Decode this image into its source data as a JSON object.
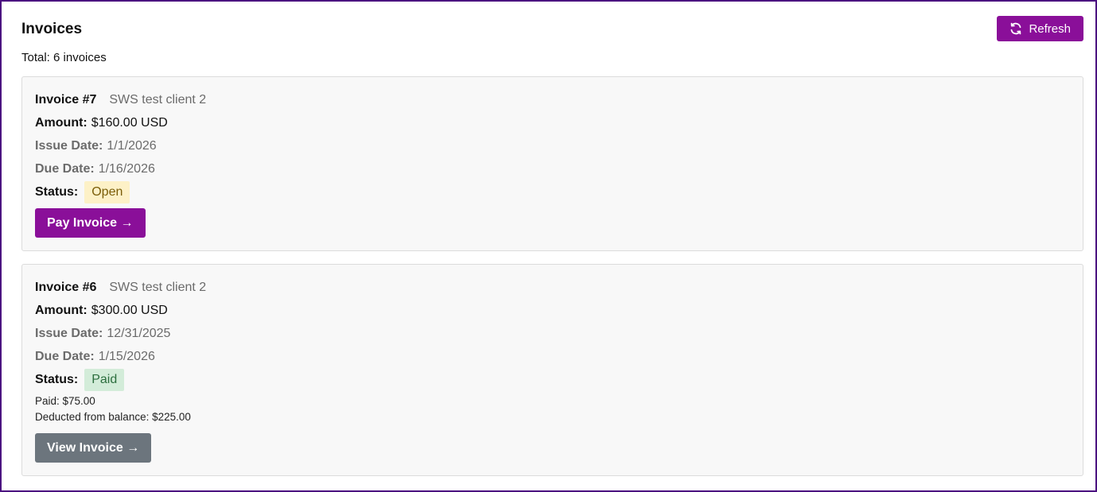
{
  "page": {
    "title": "Invoices",
    "refresh_label": "Refresh",
    "total_text": "Total: 6 invoices"
  },
  "colors": {
    "accent": "#8a0f99",
    "secondary_button": "#6c757d",
    "open_badge_bg": "#fdf1c7",
    "paid_badge_bg": "#d3ecd9",
    "frame_border": "#4b0f80"
  },
  "icons": {
    "refresh": "refresh-icon"
  },
  "invoices": [
    {
      "title": "Invoice #7",
      "client": "SWS test client 2",
      "amount_label": "Amount:",
      "amount": "$160.00 USD",
      "issue_label": "Issue Date:",
      "issue_date": "1/1/2026",
      "due_label": "Due Date:",
      "due_date": "1/16/2026",
      "status_label": "Status:",
      "status": "Open",
      "action_label": "Pay Invoice →"
    },
    {
      "title": "Invoice #6",
      "client": "SWS test client 2",
      "amount_label": "Amount:",
      "amount": "$300.00 USD",
      "issue_label": "Issue Date:",
      "issue_date": "12/31/2025",
      "due_label": "Due Date:",
      "due_date": "1/15/2026",
      "status_label": "Status:",
      "status": "Paid",
      "paid_note": "Paid: $75.00",
      "balance_note": "Deducted from balance: $225.00",
      "action_label": "View Invoice →"
    }
  ]
}
